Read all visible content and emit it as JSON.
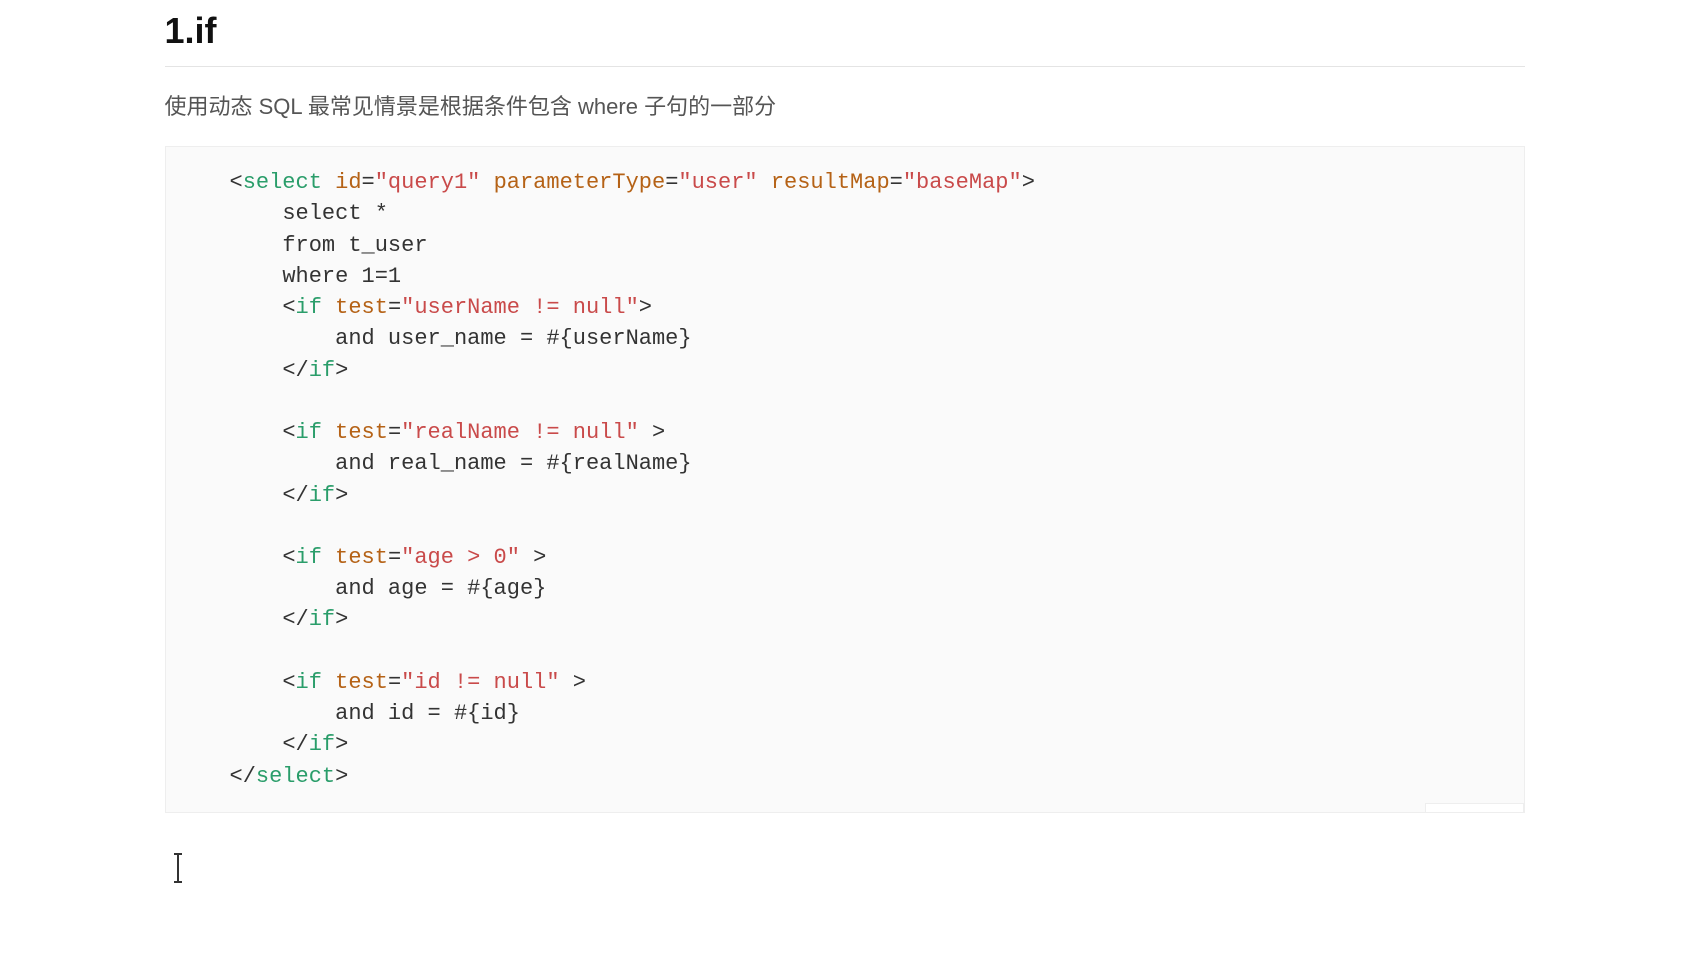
{
  "heading": "1.if",
  "description": "使用动态 SQL 最常见情景是根据条件包含 where 子句的一部分",
  "code_lang": "xml",
  "code": {
    "select_open": {
      "tag": "select",
      "attrs": [
        {
          "name": "id",
          "value": "query1"
        },
        {
          "name": "parameterType",
          "value": "user"
        },
        {
          "name": "resultMap",
          "value": "baseMap"
        }
      ]
    },
    "body_lines": [
      "select *",
      "from t_user",
      "where 1=1"
    ],
    "ifs": [
      {
        "test": "userName != null",
        "trailing_space": false,
        "content": "and user_name = #{userName}"
      },
      {
        "test": "realName != null",
        "trailing_space": true,
        "content": "and real_name = #{realName}"
      },
      {
        "test": "age > 0",
        "trailing_space": true,
        "content": "and age = #{age}"
      },
      {
        "test": "id != null",
        "trailing_space": true,
        "content": "and id = #{id}"
      }
    ],
    "select_close": "select"
  }
}
